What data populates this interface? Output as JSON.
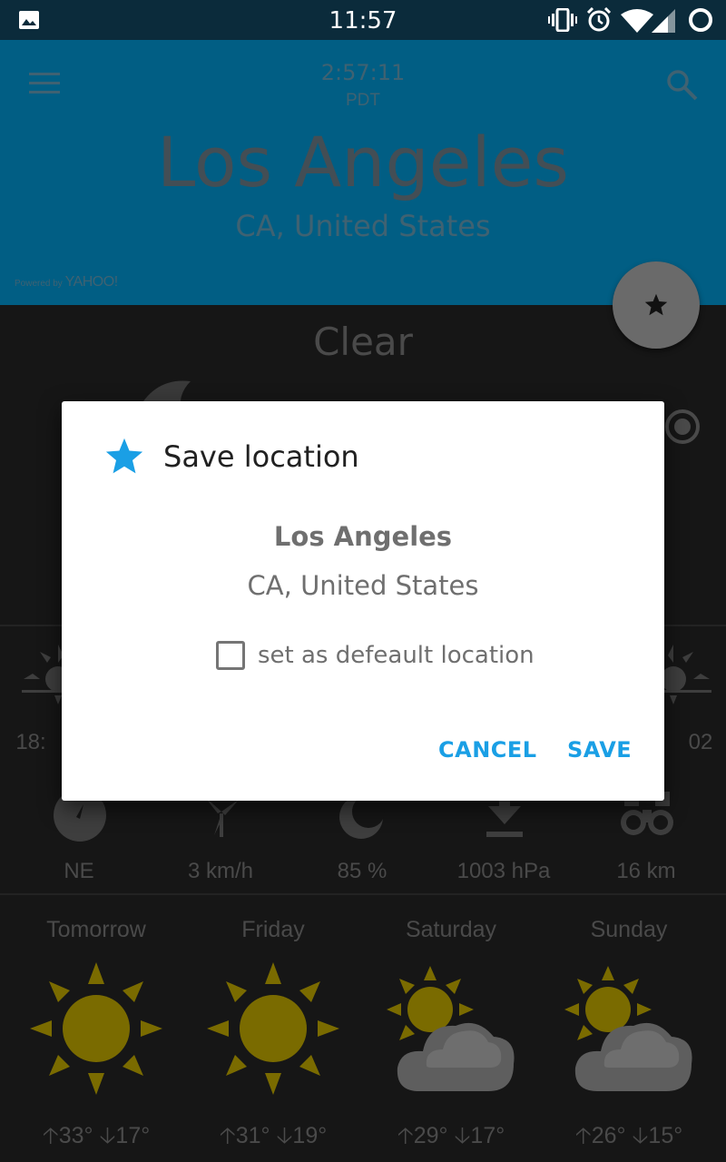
{
  "status_bar": {
    "time": "11:57",
    "icons": [
      "image-icon",
      "vibrate-icon",
      "alarm-icon",
      "wifi-icon",
      "signal-icon",
      "sync-icon"
    ]
  },
  "header": {
    "local_time": "2:57:11",
    "timezone": "PDT",
    "city": "Los Angeles",
    "region": "CA, United States",
    "powered_prefix": "Powered by",
    "powered_brand": "YAHOO!",
    "menu_icon": "menu-icon",
    "search_icon": "search-icon",
    "background_color": "#015e84"
  },
  "fab": {
    "icon": "star-icon"
  },
  "current": {
    "condition": "Clear",
    "sunrise_partial": "18:",
    "sunset_partial": "02"
  },
  "metrics": [
    {
      "icon": "compass-icon",
      "value": "NE"
    },
    {
      "icon": "windmill-icon",
      "value": "3 km/h"
    },
    {
      "icon": "humidity-icon",
      "value": "85 %"
    },
    {
      "icon": "pressure-icon",
      "value": "1003 hPa"
    },
    {
      "icon": "binoculars-icon",
      "value": "16 km"
    }
  ],
  "forecast": [
    {
      "day": "Tomorrow",
      "icon": "sun-icon",
      "high": "33°",
      "low": "17°"
    },
    {
      "day": "Friday",
      "icon": "sun-icon",
      "high": "31°",
      "low": "19°"
    },
    {
      "day": "Saturday",
      "icon": "partly-cloudy-icon",
      "high": "29°",
      "low": "17°"
    },
    {
      "day": "Sunday",
      "icon": "partly-cloudy-icon",
      "high": "26°",
      "low": "15°"
    }
  ],
  "dialog": {
    "title": "Save location",
    "city": "Los Angeles",
    "region": "CA, United States",
    "checkbox_label": "set as defeault location",
    "checkbox_checked": false,
    "cancel_label": "CANCEL",
    "save_label": "SAVE",
    "accent_color": "#1a9fe5"
  }
}
